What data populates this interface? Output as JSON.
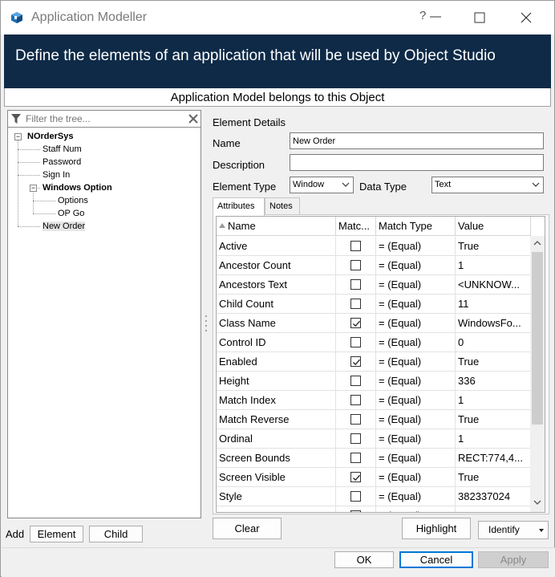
{
  "window": {
    "title": "Application Modeller",
    "help_label": "?"
  },
  "banner": {
    "text": "Define the elements of an application that will be used by Object Studio"
  },
  "belongs_bar": {
    "text": "Application Model belongs to this Object"
  },
  "tree": {
    "filter_placeholder": "Filter the tree...",
    "nodes": [
      {
        "label": "NOrderSys"
      },
      {
        "label": "Staff Num"
      },
      {
        "label": "Password"
      },
      {
        "label": "Sign In"
      },
      {
        "label": "Windows Option"
      },
      {
        "label": "Options"
      },
      {
        "label": "OP Go"
      },
      {
        "label": "New Order"
      }
    ]
  },
  "add": {
    "label": "Add",
    "element_label": "Element",
    "child_label": "Child"
  },
  "details": {
    "section_title": "Element Details",
    "name_label": "Name",
    "name_value": "New Order",
    "description_label": "Description",
    "description_value": "",
    "element_type_label": "Element Type",
    "element_type_value": "Window",
    "data_type_label": "Data Type",
    "data_type_value": "Text"
  },
  "tabs": [
    {
      "label": "Attributes"
    },
    {
      "label": "Notes"
    }
  ],
  "grid": {
    "headers": {
      "name": "Name",
      "match": "Matc...",
      "match_type": "Match Type",
      "value": "Value"
    },
    "rows": [
      {
        "name": "Active",
        "checked": false,
        "match_type": "=  (Equal)",
        "value": "True"
      },
      {
        "name": "Ancestor Count",
        "checked": false,
        "match_type": "=  (Equal)",
        "value": "1"
      },
      {
        "name": "Ancestors Text",
        "checked": false,
        "match_type": "=  (Equal)",
        "value": "<UNKNOW..."
      },
      {
        "name": "Child Count",
        "checked": false,
        "match_type": "=  (Equal)",
        "value": "11"
      },
      {
        "name": "Class Name",
        "checked": true,
        "match_type": "=  (Equal)",
        "value": "WindowsFo..."
      },
      {
        "name": "Control ID",
        "checked": false,
        "match_type": "=  (Equal)",
        "value": "0"
      },
      {
        "name": "Enabled",
        "checked": true,
        "match_type": "=  (Equal)",
        "value": "True"
      },
      {
        "name": "Height",
        "checked": false,
        "match_type": "=  (Equal)",
        "value": "336"
      },
      {
        "name": "Match Index",
        "checked": false,
        "match_type": "=  (Equal)",
        "value": "1"
      },
      {
        "name": "Match Reverse",
        "checked": false,
        "match_type": "=  (Equal)",
        "value": "True"
      },
      {
        "name": "Ordinal",
        "checked": false,
        "match_type": "=  (Equal)",
        "value": "1"
      },
      {
        "name": "Screen Bounds",
        "checked": false,
        "match_type": "=  (Equal)",
        "value": "RECT:774,4..."
      },
      {
        "name": "Screen Visible",
        "checked": true,
        "match_type": "=  (Equal)",
        "value": "True"
      },
      {
        "name": "Style",
        "checked": false,
        "match_type": "=  (Equal)",
        "value": "382337024"
      },
      {
        "name": "Type Name",
        "checked": false,
        "match_type": "=  (Equal)",
        "value": ""
      }
    ]
  },
  "actions": {
    "clear_label": "Clear",
    "highlight_label": "Highlight",
    "identify_label": "Identify"
  },
  "footer": {
    "ok_label": "OK",
    "cancel_label": "Cancel",
    "apply_label": "Apply"
  },
  "colors": {
    "banner_bg": "#0e2a47",
    "focus_blue": "#0078d7"
  }
}
